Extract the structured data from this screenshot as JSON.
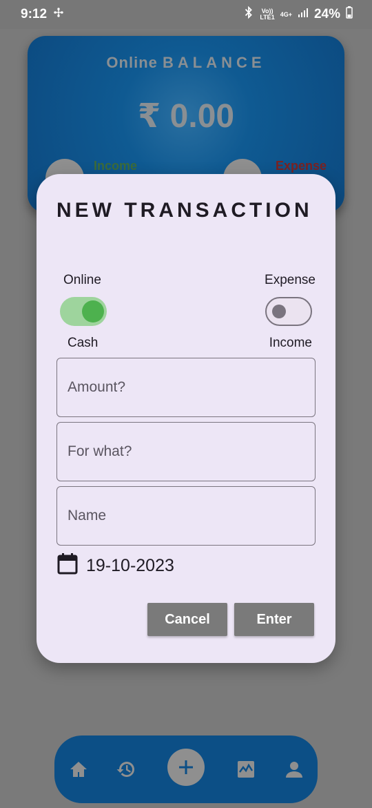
{
  "status_bar": {
    "time": "9:12",
    "network_top": "Vo))",
    "network_bottom": "LTE1",
    "signal_label": "4G+",
    "battery": "24%"
  },
  "balance_card": {
    "title_prefix": "Online",
    "title_word": "BALANCE",
    "amount": "₹ 0.00",
    "income_label": "Income",
    "expense_label": "Expense"
  },
  "dialog": {
    "title": "NEW TRANSACTION",
    "toggle_mode": {
      "label_on": "Online",
      "label_off": "Cash",
      "state": "on"
    },
    "toggle_type": {
      "label_on": "Expense",
      "label_off": "Income",
      "state": "off"
    },
    "amount_placeholder": "Amount?",
    "for_what_placeholder": "For what?",
    "name_placeholder": "Name",
    "date": "19-10-2023",
    "cancel_label": "Cancel",
    "enter_label": "Enter"
  },
  "colors": {
    "dialog_bg": "#ede6f6",
    "card_blue": "#0c4a80",
    "switch_on": "#4db14e",
    "button_gray": "#7a7a7a"
  },
  "icons": [
    "home-icon",
    "history-icon",
    "add-icon",
    "chart-icon",
    "profile-icon",
    "calendar-icon"
  ]
}
